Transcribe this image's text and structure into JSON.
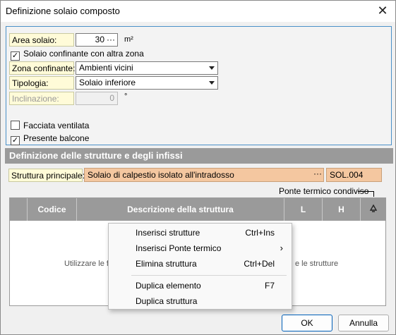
{
  "window": {
    "title": "Definizione solaio composto"
  },
  "form": {
    "area_label": "Area solaio:",
    "area_value": "30",
    "area_unit": "m²",
    "confinante_check_label": "Solaio confinante con altra zona",
    "confinante_checked": true,
    "zona_label": "Zona confinante:",
    "zona_value": "Ambienti vicini",
    "tipologia_label": "Tipologia:",
    "tipologia_value": "Solaio inferiore",
    "inclinazione_label": "Inclinazione:",
    "inclinazione_value": "0",
    "inclinazione_unit": "°",
    "facciata_label": "Facciata ventilata",
    "facciata_checked": false,
    "balcone_label": "Presente balcone",
    "balcone_checked": true
  },
  "structures": {
    "section_title": "Definizione delle strutture e degli infissi",
    "principal_label": "Struttura principale:",
    "principal_value": "Solaio di calpestio isolato all'intradosso",
    "principal_code": "SOL.004",
    "ellipsis": "···",
    "ponte_label": "Ponte termico condiviso",
    "table_headers": {
      "codice": "Codice",
      "descrizione": "Descrizione della struttura",
      "l": "L",
      "h": "H"
    },
    "empty_left": "Utilizzare le fu",
    "empty_right": "e le strutture"
  },
  "context_menu": {
    "items": [
      {
        "label": "Inserisci strutture",
        "shortcut": "Ctrl+Ins"
      },
      {
        "label": "Inserisci Ponte termico",
        "shortcut": ""
      },
      {
        "label": "Elimina struttura",
        "shortcut": "Ctrl+Del"
      },
      {
        "label": "Duplica elemento",
        "shortcut": "F7"
      },
      {
        "label": "Duplica struttura",
        "shortcut": ""
      }
    ]
  },
  "buttons": {
    "ok": "OK",
    "cancel": "Annulla"
  }
}
